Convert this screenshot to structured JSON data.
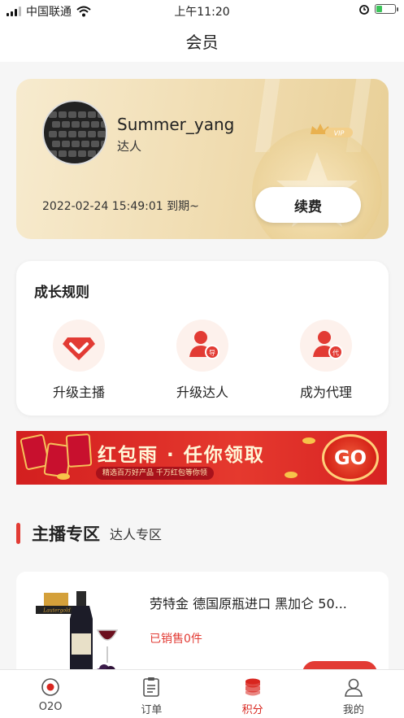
{
  "status_bar": {
    "carrier": "中国联通",
    "time": "上午11:20",
    "battery_level": 0.3,
    "icons": [
      "signal-icon",
      "wifi-icon",
      "alarm-icon",
      "battery-icon"
    ]
  },
  "header": {
    "title": "会员"
  },
  "member_card": {
    "username": "Summer_yang",
    "level": "达人",
    "expire_text": "2022-02-24 15:49:01 到期~",
    "renew_label": "续费",
    "badge": "VIP"
  },
  "growth_rules": {
    "title": "成长规则",
    "items": [
      {
        "label": "升级主播",
        "icon": "diamond-icon"
      },
      {
        "label": "升级达人",
        "icon": "user-star-icon",
        "badge": "导"
      },
      {
        "label": "成为代理",
        "icon": "user-agent-icon",
        "badge": "代"
      }
    ]
  },
  "banner": {
    "title": "红包雨 · 任你领取",
    "subtitle": "精选百万好产品  千万红包等你领",
    "cta": "GO"
  },
  "zone_tabs": {
    "active": "主播专区",
    "inactive": "达人专区"
  },
  "product": {
    "title": "劳特金 德国原瓶进口 黑加仑 50...",
    "sold": "已销售0件",
    "brand": "Lautergold"
  },
  "bottom_nav": {
    "items": [
      {
        "label": "O2O",
        "icon": "o2o-icon",
        "active": false
      },
      {
        "label": "订单",
        "icon": "order-icon",
        "active": false
      },
      {
        "label": "积分",
        "icon": "points-icon",
        "active": true
      },
      {
        "label": "我的",
        "icon": "profile-icon",
        "active": false
      }
    ]
  },
  "colors": {
    "accent": "#e23b34",
    "gold": "#f0dcb0"
  }
}
